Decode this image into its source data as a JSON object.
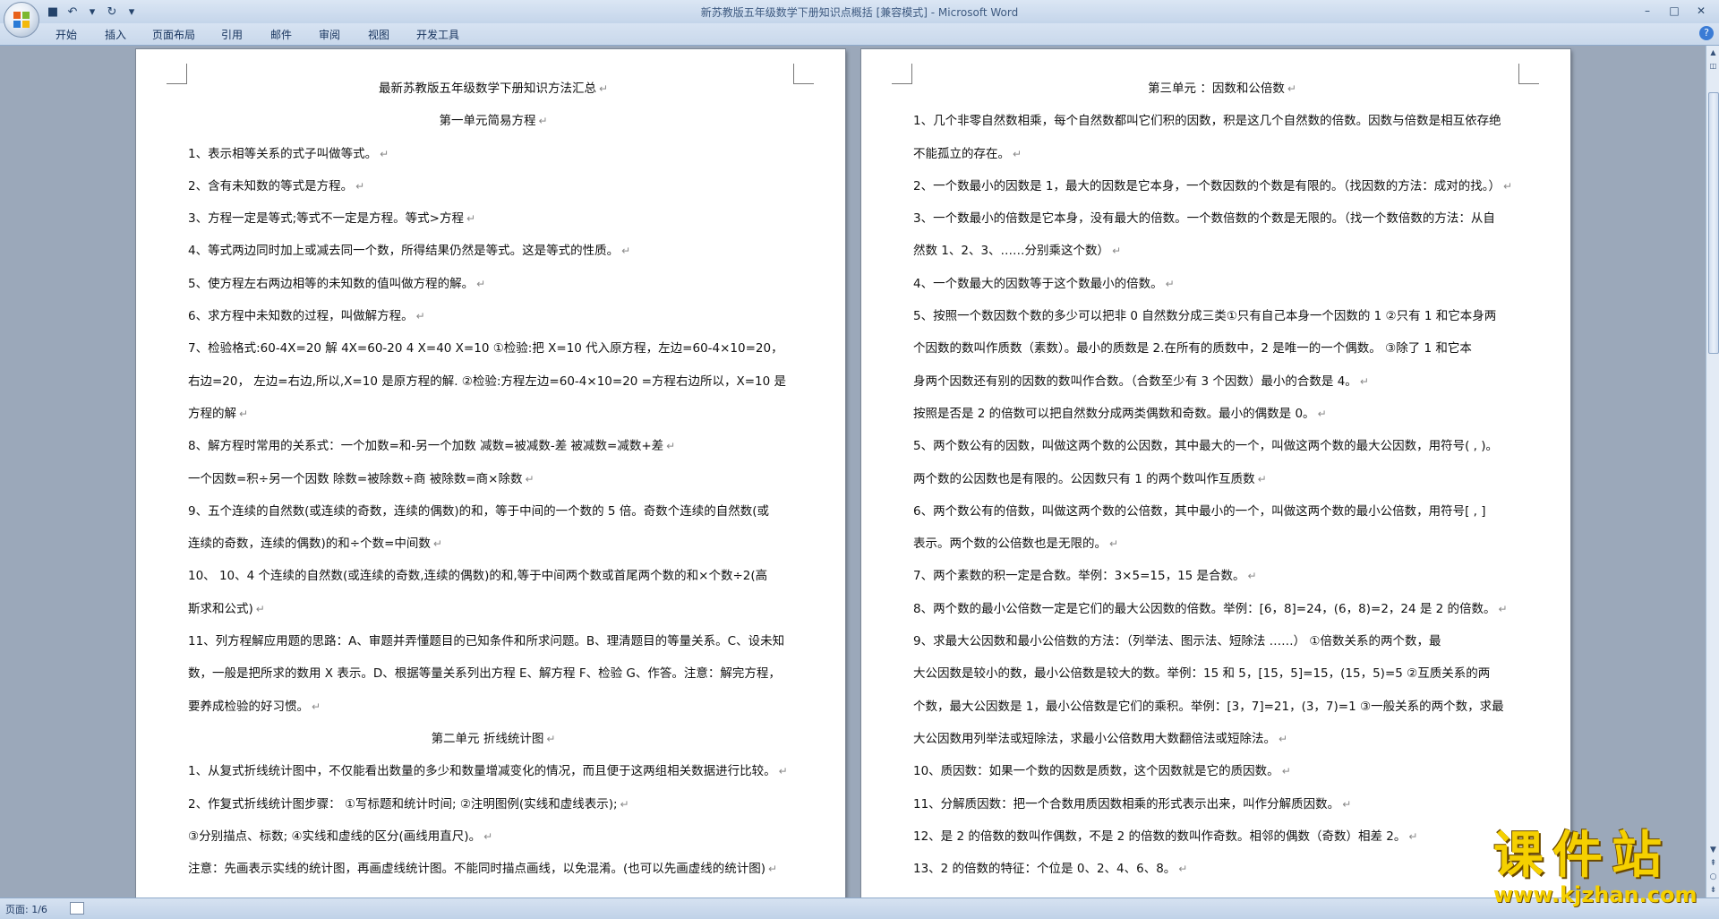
{
  "window": {
    "title": "新苏教版五年级数学下册知识点概括 [兼容模式] - Microsoft Word"
  },
  "quick_access": [
    {
      "name": "save-icon",
      "glyph": "■"
    },
    {
      "name": "undo-icon",
      "glyph": "↶"
    },
    {
      "name": "dropdown-icon",
      "glyph": "▾"
    },
    {
      "name": "redo-icon",
      "glyph": "↻"
    },
    {
      "name": "customize-icon",
      "glyph": "▾"
    }
  ],
  "window_controls": {
    "minimize": "–",
    "maximize": "□",
    "close": "✕"
  },
  "ribbon": {
    "tabs": [
      {
        "label": "开始"
      },
      {
        "label": "插入"
      },
      {
        "label": "页面布局"
      },
      {
        "label": "引用"
      },
      {
        "label": "邮件"
      },
      {
        "label": "审阅"
      },
      {
        "label": "视图"
      },
      {
        "label": "开发工具"
      }
    ],
    "help": "?"
  },
  "page1": {
    "lines": [
      {
        "t": "最新苏教版五年级数学下册知识方法汇总",
        "c": true
      },
      {
        "t": "第一单元简易方程",
        "c": true
      },
      {
        "t": "1、表示相等关系的式子叫做等式。"
      },
      {
        "t": "2、含有未知数的等式是方程。"
      },
      {
        "t": "3、方程一定是等式;等式不一定是方程。等式>方程"
      },
      {
        "t": "4、等式两边同时加上或减去同一个数，所得结果仍然是等式。这是等式的性质。"
      },
      {
        "t": "5、使方程左右两边相等的未知数的值叫做方程的解。"
      },
      {
        "t": "6、求方程中未知数的过程，叫做解方程。"
      },
      {
        "t": "7、检验格式:60-4X=20      解 4X=60-20     4 X=40       X=10    ①检验:把 X=10 代入原方程，左边=60-4×10=20，",
        "p": false
      },
      {
        "t": "右边=20，      左边=右边,所以,X=10 是原方程的解.    ②检验:方程左边=60-4×10=20   =方程右边所以，X=10 是",
        "p": false
      },
      {
        "t": "方程的解"
      },
      {
        "t": "8、解方程时常用的关系式：一个加数=和-另一个加数       减数=被减数-差       被减数=减数+差"
      },
      {
        "t": "               一个因数=积÷另一个因数       除数=被除数÷商     被除数=商×除数"
      },
      {
        "t": "9、五个连续的自然数(或连续的奇数，连续的偶数)的和，等于中间的一个数的 5 倍。奇数个连续的自然数(或",
        "p": false
      },
      {
        "t": "连续的奇数，连续的偶数)的和÷个数=中间数"
      },
      {
        "t": "10、  10、4 个连续的自然数(或连续的奇数,连续的偶数)的和,等于中间两个数或首尾两个数的和×个数÷2(高",
        "p": false
      },
      {
        "t": "斯求和公式)"
      },
      {
        "t": "11、列方程解应用题的思路：A、审题并弄懂题目的已知条件和所求问题。B、理清题目的等量关系。C、设未知",
        "p": false
      },
      {
        "t": "数，一般是把所求的数用 X 表示。D、根据等量关系列出方程 E、解方程 F、检验 G、作答。注意：解完方程，",
        "p": false
      },
      {
        "t": "要养成检验的好习惯。"
      },
      {
        "t": "第二单元  折线统计图",
        "c": true
      },
      {
        "t": "   1、从复式折线统计图中，不仅能看出数量的多少和数量增减变化的情况，而且便于这两组相关数据进行比较。"
      },
      {
        "t": "   2、作复式折线统计图步骤：       ①写标题和统计时间;       ②注明图例(实线和虚线表示);"
      },
      {
        "t": "                                      ③分别描点、标数;       ④实线和虚线的区分(画线用直尺)。"
      },
      {
        "t": "注意：先画表示实线的统计图，再画虚线统计图。不能同时描点画线，以免混淆。(也可以先画虚线的统计图)"
      }
    ]
  },
  "page2": {
    "lines": [
      {
        "t": "第三单元    ：因数和公倍数",
        "c": true
      },
      {
        "t": "1、几个非零自然数相乘，每个自然数都叫它们积的因数，积是这几个自然数的倍数。因数与倍数是相互依存绝",
        "p": false
      },
      {
        "t": "不能孤立的存在。"
      },
      {
        "t": "2、一个数最小的因数是 1，最大的因数是它本身，一个数因数的个数是有限的。（找因数的方法：成对的找。）"
      },
      {
        "t": "3、一个数最小的倍数是它本身，没有最大的倍数。一个数倍数的个数是无限的。（找一个数倍数的方法：从自",
        "p": false
      },
      {
        "t": "然数 1、2、3、……分别乘这个数）"
      },
      {
        "t": "4、一个数最大的因数等于这个数最小的倍数。"
      },
      {
        "t": "5、按照一个数因数个数的多少可以把非 0 自然数分成三类①只有自己本身一个因数的 1    ②只有 1 和它本身两",
        "p": false
      },
      {
        "t": "   个因数的数叫作质数（素数）。最小的质数是 2.在所有的质数中，2 是唯一的一个偶数。   ③除了 1 和它本",
        "p": false
      },
      {
        "t": "   身两个因数还有别的因数的数叫作合数。（合数至少有 3 个因数）最小的合数是 4。"
      },
      {
        "t": "   按照是否是 2 的倍数可以把自然数分成两类偶数和奇数。最小的偶数是 0。"
      },
      {
        "t": "5、两个数公有的因数，叫做这两个数的公因数，其中最大的一个，叫做这两个数的最大公因数，用符号(  ,  )。",
        "p": false
      },
      {
        "t": "两个数的公因数也是有限的。公因数只有 1 的两个数叫作互质数"
      },
      {
        "t": " 6、两个数公有的倍数，叫做这两个数的公倍数，其中最小的一个，叫做这两个数的最小公倍数，用符号[  ,  ]",
        "p": false
      },
      {
        "t": "表示。两个数的公倍数也是无限的。"
      },
      {
        "t": "7、两个素数的积一定是合数。举例：3×5=15，15 是合数。"
      },
      {
        "t": "8、两个数的最小公倍数一定是它们的最大公因数的倍数。举例：[6，8]=24，(6，8)=2，24 是 2 的倍数。"
      },
      {
        "t": "9、求最大公因数和最小公倍数的方法：（列举法、图示法、短除法    ……）           ①倍数关系的两个数，最",
        "p": false
      },
      {
        "t": "大公因数是较小的数，最小公倍数是较大的数。举例：15 和 5，[15，5]=15，(15，5)=5        ②互质关系的两",
        "p": false
      },
      {
        "t": "个数，最大公因数是 1，最小公倍数是它们的乘积。举例：[3，7]=21，(3，7)=1    ③一般关系的两个数，求最",
        "p": false
      },
      {
        "t": "大公因数用列举法或短除法，求最小公倍数用大数翻倍法或短除法。"
      },
      {
        "t": "10、质因数：如果一个数的因数是质数，这个因数就是它的质因数。"
      },
      {
        "t": "11、分解质因数：把一个合数用质因数相乘的形式表示出来，叫作分解质因数。"
      },
      {
        "t": "12、是 2 的倍数的数叫作偶数，不是 2 的倍数的数叫作奇数。相邻的偶数（奇数）相差 2。"
      },
      {
        "t": "13、2 的倍数的特征：个位是 0、2、4、6、8。"
      }
    ]
  },
  "status": {
    "page": "页面: 1/6"
  },
  "watermark": {
    "cn": "课件站",
    "url": "www.kjzhan.com"
  },
  "para_mark": "↵"
}
